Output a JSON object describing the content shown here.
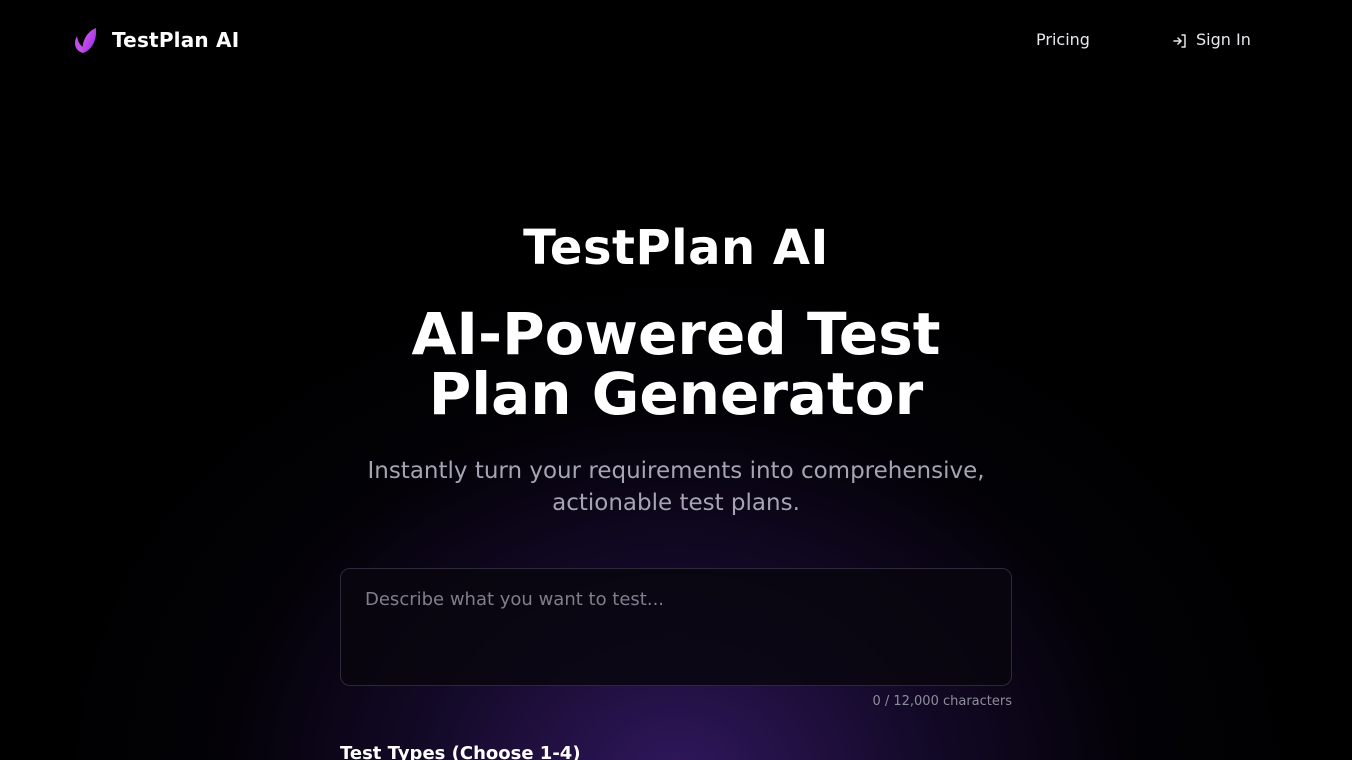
{
  "header": {
    "brand_name": "TestPlan AI",
    "nav": {
      "pricing_label": "Pricing",
      "signin_label": "Sign In"
    }
  },
  "hero": {
    "brand": "TestPlan AI",
    "title": "AI-Powered Test Plan Generator",
    "subtitle": "Instantly turn your requirements into comprehensive, actionable test plans."
  },
  "prompt": {
    "value": "",
    "placeholder": "Describe what you want to test...",
    "char_count": "0 / 12,000 characters"
  },
  "test_types": {
    "label": "Test Types (Choose 1-4)"
  },
  "colors": {
    "background": "#000000",
    "accent_purple": "#a53ff0",
    "accent_pink": "#e25cf2",
    "subtitle_gray": "#a5a4b3"
  },
  "icons": {
    "brand_logo": "leaf-flame-icon",
    "signin": "login-arrow-icon"
  }
}
